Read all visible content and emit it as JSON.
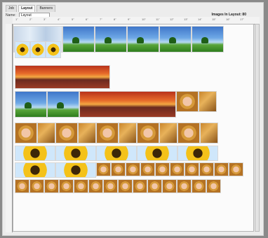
{
  "tabs": [
    "Job",
    "Layout",
    "Banners"
  ],
  "name_label": "Name:",
  "name_value": "Layout",
  "images_label": "Images In Layout: 80",
  "ruler_ticks": [
    "1\"",
    "2\"",
    "3\"",
    "4\"",
    "5\"",
    "6\"",
    "7\"",
    "8\"",
    "9\"",
    "10\"",
    "11\"",
    "12\"",
    "13\"",
    "14\"",
    "15\"",
    "16\"",
    "17\""
  ],
  "colors": {
    "frame": "#ececec",
    "canvas": "#fbfbfb",
    "sky": "#6ea8e6",
    "sunset": "#e76b2a",
    "sunflower": "#f4c21a"
  }
}
